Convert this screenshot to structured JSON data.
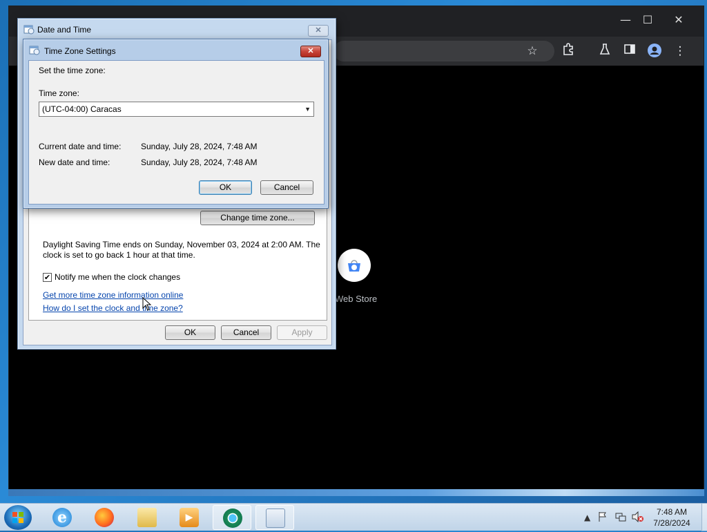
{
  "browser": {
    "window_controls": [
      "—",
      "☐",
      "✕"
    ],
    "webstore_label": "Web Store"
  },
  "date_time_dialog": {
    "title": "Date and Time",
    "change_time_zone_button": "Change time zone...",
    "dst_text_line1": "Daylight Saving Time ends on Sunday, November 03, 2024 at 2:00 AM. The",
    "dst_text_line2": "clock is set to go back 1 hour at that time.",
    "notify_checkbox_label": "Notify me when the clock changes",
    "notify_checked": true,
    "link_more_info": "Get more time zone information online",
    "link_how_set": "How do I set the clock and time zone?",
    "ok_button": "OK",
    "cancel_button": "Cancel",
    "apply_button": "Apply"
  },
  "tz_dialog": {
    "title": "Time Zone Settings",
    "set_label": "Set the time zone:",
    "time_zone_label": "Time zone:",
    "time_zone_value": "(UTC-04:00) Caracas",
    "current_label": "Current date and time:",
    "current_value": "Sunday, July 28, 2024, 7:48 AM",
    "new_label": "New date and time:",
    "new_value": "Sunday, July 28, 2024, 7:48 AM",
    "ok_button": "OK",
    "cancel_button": "Cancel"
  },
  "taskbar": {
    "apps": [
      "start-button",
      "internet-explorer-icon",
      "firefox-icon",
      "file-explorer-icon",
      "media-player-icon",
      "chrome-icon",
      "date-time-app-icon"
    ],
    "tray_chevron": "▲",
    "clock_time": "7:48 AM",
    "clock_date": "7/28/2024"
  },
  "colors": {
    "dialog_frame": "#c5d9ef",
    "link": "#0645ad",
    "close_red": "#c7443a"
  }
}
